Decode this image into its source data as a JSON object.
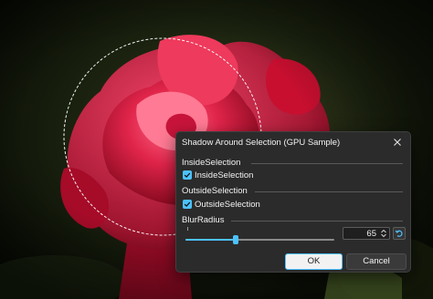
{
  "dialog": {
    "title": "Shadow Around Selection (GPU Sample)",
    "inside": {
      "section_label": "InsideSelection",
      "checkbox_label": "InsideSelection",
      "checked": true
    },
    "outside": {
      "section_label": "OutsideSelection",
      "checkbox_label": "OutsideSelection",
      "checked": true
    },
    "blur": {
      "section_label": "BlurRadius",
      "value": "65"
    },
    "ok_label": "OK",
    "cancel_label": "Cancel"
  },
  "icons": {
    "close": "close-icon",
    "check": "checkmark-icon",
    "spin_up": "chevron-up-icon",
    "spin_down": "chevron-down-icon",
    "reset": "reset-arrow-icon"
  },
  "colors": {
    "accent": "#4cc2ff",
    "dialog_bg": "#2b2b2b",
    "rose": "#d4143c"
  }
}
